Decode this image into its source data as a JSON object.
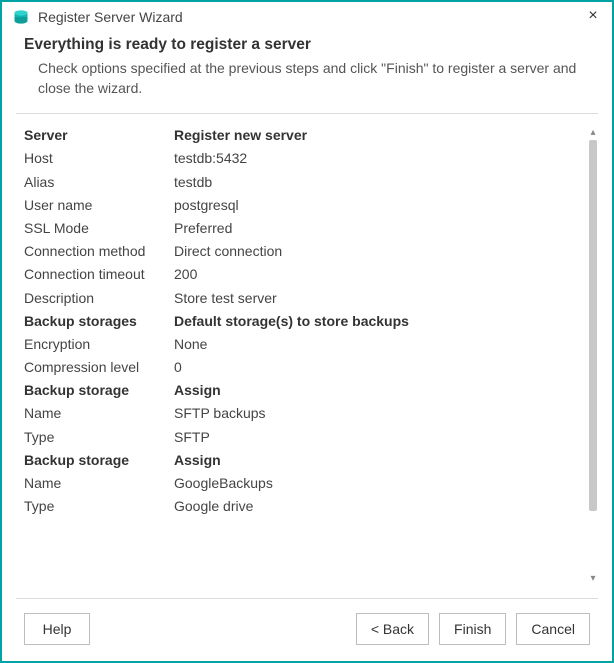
{
  "window": {
    "title": "Register Server Wizard"
  },
  "header": {
    "heading": "Everything is ready to register a server",
    "subheading": "Check options specified at the previous steps and click \"Finish\" to register a server and close the wizard."
  },
  "summary": [
    {
      "label": "Server",
      "value": "Register new server",
      "section": true
    },
    {
      "label": "Host",
      "value": "testdb:5432",
      "section": false
    },
    {
      "label": "Alias",
      "value": "testdb",
      "section": false
    },
    {
      "label": "User name",
      "value": "postgresql",
      "section": false
    },
    {
      "label": "SSL Mode",
      "value": "Preferred",
      "section": false
    },
    {
      "label": "Connection method",
      "value": "Direct connection",
      "section": false
    },
    {
      "label": "Connection timeout",
      "value": "200",
      "section": false
    },
    {
      "label": "Description",
      "value": "Store test server",
      "section": false
    },
    {
      "label": "Backup storages",
      "value": "Default storage(s) to store backups",
      "section": true
    },
    {
      "label": "Encryption",
      "value": "None",
      "section": false
    },
    {
      "label": "Compression level",
      "value": "0",
      "section": false
    },
    {
      "label": "Backup storage",
      "value": "Assign",
      "section": true
    },
    {
      "label": "Name",
      "value": "SFTP backups",
      "section": false
    },
    {
      "label": "Type",
      "value": "SFTP",
      "section": false
    },
    {
      "label": "Backup storage",
      "value": "Assign",
      "section": true
    },
    {
      "label": "Name",
      "value": "GoogleBackups",
      "section": false
    },
    {
      "label": "Type",
      "value": "Google drive",
      "section": false
    }
  ],
  "buttons": {
    "help": "Help",
    "back": "< Back",
    "finish": "Finish",
    "cancel": "Cancel"
  }
}
